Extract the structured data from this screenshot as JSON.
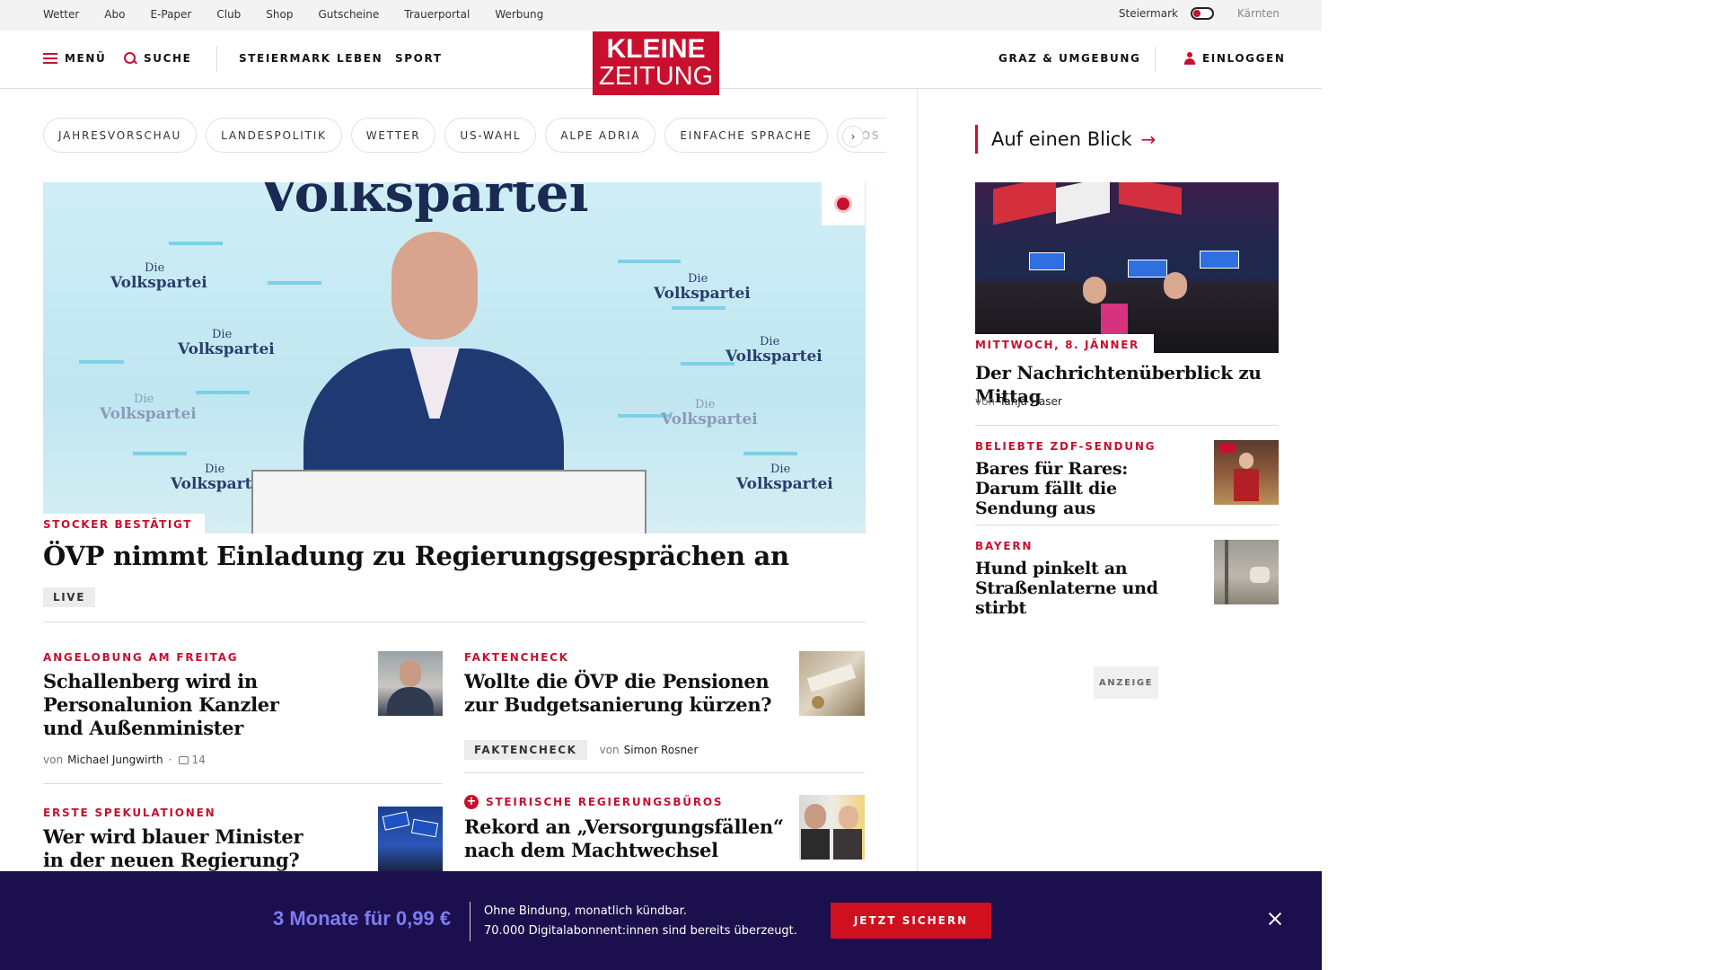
{
  "topbar": {
    "links": [
      "Wetter",
      "Abo",
      "E-Paper",
      "Club",
      "Shop",
      "Gutscheine",
      "Trauerportal",
      "Werbung"
    ],
    "region_active": "Steiermark",
    "region_other": "Kärnten"
  },
  "header": {
    "menu_label": "MENÜ",
    "search_label": "SUCHE",
    "nav": [
      "STEIERMARK",
      "LEBEN",
      "SPORT"
    ],
    "logo_line1": "KLEINE",
    "logo_line2": "ZEITUNG",
    "local_label": "GRAZ & UMGEBUNG",
    "login_label": "EINLOGGEN"
  },
  "tags": [
    "JAHRESVORSCHAU",
    "LANDESPOLITIK",
    "WETTER",
    "US-WAHL",
    "ALPE ADRIA",
    "EINFACHE SPRACHE",
    "DOS"
  ],
  "hero": {
    "kicker": "STOCKER BESTÄTIGT",
    "title": "ÖVP nimmt Einladung zu Regierungsgesprächen an",
    "badge": "LIVE",
    "image_words": {
      "big": "Volkspartei",
      "small": "Die",
      "main": "Volkspartei",
      "podium": "Die"
    }
  },
  "articles": [
    {
      "kicker": "ANGELOBUNG AM FREITAG",
      "title": "Schallenberg wird in Personalunion Kanzler und Außenminister",
      "by": "von",
      "author": "Michael Jungwirth",
      "comments": "14"
    },
    {
      "kicker": "FAKTENCHECK",
      "title": "Wollte die ÖVP die Pensionen zur Budgetsanierung kürzen?",
      "badge": "FAKTENCHECK",
      "by": "von",
      "author": "Simon Rosner"
    },
    {
      "kicker": "ERSTE SPEKULATIONEN",
      "title": "Wer wird blauer Minister in der neuen Regierung?"
    },
    {
      "kicker": "STEIRISCHE REGIERUNGSBÜROS",
      "title": "Rekord an „Versorgungsfällen“ nach dem Machtwechsel"
    }
  ],
  "sidebar": {
    "heading": "Auf einen Blick",
    "lead": {
      "date": "MITTWOCH, 8. JÄNNER",
      "title": "Der Nachrichtenüberblick zu Mittag",
      "by": "von",
      "author": "Tanja Haser"
    },
    "items": [
      {
        "kicker": "BELIEBTE ZDF-SENDUNG",
        "title": "Bares für Rares: Darum fällt die Sendung aus"
      },
      {
        "kicker": "BAYERN",
        "title": "Hund pinkelt an Straßenlaterne und stirbt"
      }
    ],
    "ad_label": "ANZEIGE"
  },
  "promo": {
    "price": "3 Monate für 0,99 €",
    "line1": "Ohne Bindung, monatlich kündbar.",
    "line2": "70.000 Digitalabonnent:innen sind bereits überzeugt.",
    "cta": "JETZT SICHERN"
  },
  "colors": {
    "brand": "#c8102e",
    "promo_bg": "#1c0f4d",
    "promo_price": "#7e7cf0"
  }
}
